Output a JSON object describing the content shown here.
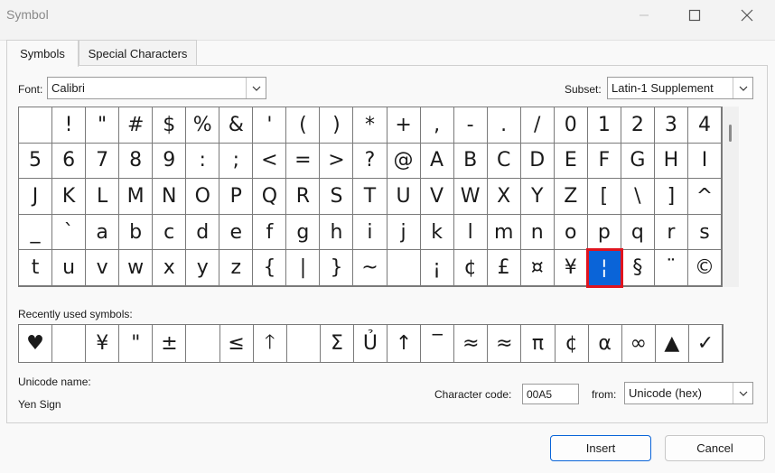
{
  "window": {
    "title": "Symbol"
  },
  "tabs": [
    {
      "label": "Symbols"
    },
    {
      "label": "Special Characters"
    }
  ],
  "font": {
    "label": "Font:",
    "value": "Calibri"
  },
  "subset": {
    "label": "Subset:",
    "value": "Latin-1 Supplement"
  },
  "symbol_grid": {
    "columns": 21,
    "selected_index": 101,
    "symbols": [
      "",
      "!",
      "\"",
      "#",
      "$",
      "%",
      "&",
      "'",
      "(",
      ")",
      "*",
      "+",
      ",",
      "-",
      ".",
      "/",
      "0",
      "1",
      "2",
      "3",
      "4",
      "5",
      "6",
      "7",
      "8",
      "9",
      ":",
      ";",
      "<",
      "=",
      ">",
      "?",
      "@",
      "A",
      "B",
      "C",
      "D",
      "E",
      "F",
      "G",
      "H",
      "I",
      "J",
      "K",
      "L",
      "M",
      "N",
      "O",
      "P",
      "Q",
      "R",
      "S",
      "T",
      "U",
      "V",
      "W",
      "X",
      "Y",
      "Z",
      "[",
      "\\",
      "]",
      "^",
      "_",
      "`",
      "a",
      "b",
      "c",
      "d",
      "e",
      "f",
      "g",
      "h",
      "i",
      "j",
      "k",
      "l",
      "m",
      "n",
      "o",
      "p",
      "q",
      "r",
      "s",
      "t",
      "u",
      "v",
      "w",
      "x",
      "y",
      "z",
      "{",
      "|",
      "}",
      "~",
      "",
      "¡",
      "¢",
      "£",
      "¤",
      "¥",
      "¦",
      "§",
      "¨",
      "©"
    ]
  },
  "recent": {
    "label": "Recently used symbols:",
    "symbols": [
      "♥",
      "",
      "¥",
      "\"",
      "±",
      "",
      "≤",
      "🡑",
      "",
      "Σ",
      "Ủ",
      "↑",
      "‾",
      "≈",
      "≈",
      "π",
      "¢",
      "α",
      "∞",
      "▲",
      "✓"
    ]
  },
  "unicode": {
    "name_label": "Unicode name:",
    "name_value": "Yen Sign"
  },
  "char_code": {
    "label": "Character code:",
    "value": "00A5"
  },
  "from": {
    "label": "from:",
    "value": "Unicode (hex)"
  },
  "buttons": {
    "insert": "Insert",
    "cancel": "Cancel"
  }
}
